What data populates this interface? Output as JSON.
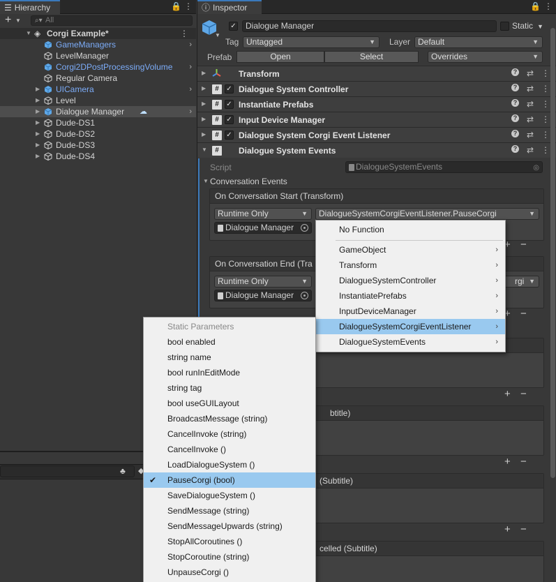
{
  "hierarchy": {
    "tab_label": "Hierarchy",
    "add_label": "+",
    "search_placeholder": "All",
    "scene_name": "Corgi Example*",
    "items": [
      {
        "label": "GameManagers",
        "prefab": true,
        "icon": "prefab-cube-icon"
      },
      {
        "label": "LevelManager",
        "prefab": false,
        "icon": "gameobject-cube-icon"
      },
      {
        "label": "Corgi2DPostProcessingVolume",
        "prefab": true,
        "icon": "prefab-cube-icon"
      },
      {
        "label": "Regular Camera",
        "prefab": false,
        "icon": "gameobject-cube-icon"
      },
      {
        "label": "UICamera",
        "prefab": true,
        "icon": "prefab-cube-icon"
      },
      {
        "label": "Level",
        "prefab": false,
        "icon": "gameobject-cube-icon"
      },
      {
        "label": "Dialogue Manager",
        "prefab": false,
        "icon": "prefab-cube-icon"
      },
      {
        "label": "Dude-DS1",
        "prefab": false,
        "icon": "gameobject-cube-icon"
      },
      {
        "label": "Dude-DS2",
        "prefab": false,
        "icon": "gameobject-cube-icon"
      },
      {
        "label": "Dude-DS3",
        "prefab": false,
        "icon": "gameobject-cube-icon"
      },
      {
        "label": "Dude-DS4",
        "prefab": false,
        "icon": "gameobject-cube-icon"
      }
    ]
  },
  "inspector": {
    "tab_label": "Inspector",
    "object_name": "Dialogue Manager",
    "static_label": "Static",
    "tag_label": "Tag",
    "tag_value": "Untagged",
    "layer_label": "Layer",
    "layer_value": "Default",
    "prefab_label": "Prefab",
    "open_label": "Open",
    "select_label": "Select",
    "overrides_label": "Overrides",
    "components": [
      {
        "name": "Transform",
        "checkbox": false,
        "icon": "transform-icon"
      },
      {
        "name": "Dialogue System Controller",
        "checkbox": true,
        "icon": "script-icon"
      },
      {
        "name": "Instantiate Prefabs",
        "checkbox": true,
        "icon": "script-icon"
      },
      {
        "name": "Input Device Manager",
        "checkbox": true,
        "icon": "script-icon"
      },
      {
        "name": "Dialogue System Corgi Event Listener",
        "checkbox": true,
        "icon": "script-icon"
      },
      {
        "name": "Dialogue System Events",
        "checkbox": false,
        "icon": "script-icon"
      }
    ],
    "script_label": "Script",
    "script_value": "DialogueSystemEvents",
    "conversation_events_label": "Conversation Events",
    "events": [
      {
        "title": "On Conversation Start (Transform)",
        "mode": "Runtime Only",
        "function": "DialogueSystemCorgiEventListener.PauseCorgi",
        "object": "Dialogue Manager"
      },
      {
        "title": "On Conversation End (Tra",
        "mode": "Runtime Only",
        "function": "rgi",
        "object": "Dialogue Manager"
      },
      {
        "title": "",
        "mode": "",
        "function": "",
        "object": ""
      },
      {
        "title": "btitle)",
        "mode": "",
        "function": "",
        "object": ""
      },
      {
        "title": "(Subtitle)",
        "mode": "",
        "function": "",
        "object": ""
      },
      {
        "title": "celled (Subtitle)",
        "mode": "",
        "function": "",
        "object": ""
      }
    ],
    "plus": "+",
    "minus": "−"
  },
  "function_menu": {
    "items": [
      {
        "label": "No Function",
        "submenu": false
      },
      {
        "label": "GameObject",
        "submenu": true
      },
      {
        "label": "Transform",
        "submenu": true
      },
      {
        "label": "DialogueSystemController",
        "submenu": true
      },
      {
        "label": "InstantiatePrefabs",
        "submenu": true
      },
      {
        "label": "InputDeviceManager",
        "submenu": true
      },
      {
        "label": "DialogueSystemCorgiEventListener",
        "submenu": true,
        "highlighted": true
      },
      {
        "label": "DialogueSystemEvents",
        "submenu": true
      }
    ]
  },
  "param_menu": {
    "header": "Static Parameters",
    "items": [
      {
        "label": "bool enabled"
      },
      {
        "label": "string name"
      },
      {
        "label": "bool runInEditMode"
      },
      {
        "label": "string tag"
      },
      {
        "label": "bool useGUILayout"
      },
      {
        "label": "BroadcastMessage (string)"
      },
      {
        "label": "CancelInvoke (string)"
      },
      {
        "label": "CancelInvoke ()"
      },
      {
        "label": "LoadDialogueSystem ()"
      },
      {
        "label": "PauseCorgi (bool)",
        "checked": true
      },
      {
        "label": "SaveDialogueSystem ()"
      },
      {
        "label": "SendMessage (string)"
      },
      {
        "label": "SendMessageUpwards (string)"
      },
      {
        "label": "StopAllCoroutines ()"
      },
      {
        "label": "StopCoroutine (string)"
      },
      {
        "label": "UnpauseCorgi ()"
      }
    ]
  },
  "colors": {
    "accent": "#3a79bb",
    "highlight": "#99c9ef",
    "prefab_blue": "#7cacf8"
  }
}
